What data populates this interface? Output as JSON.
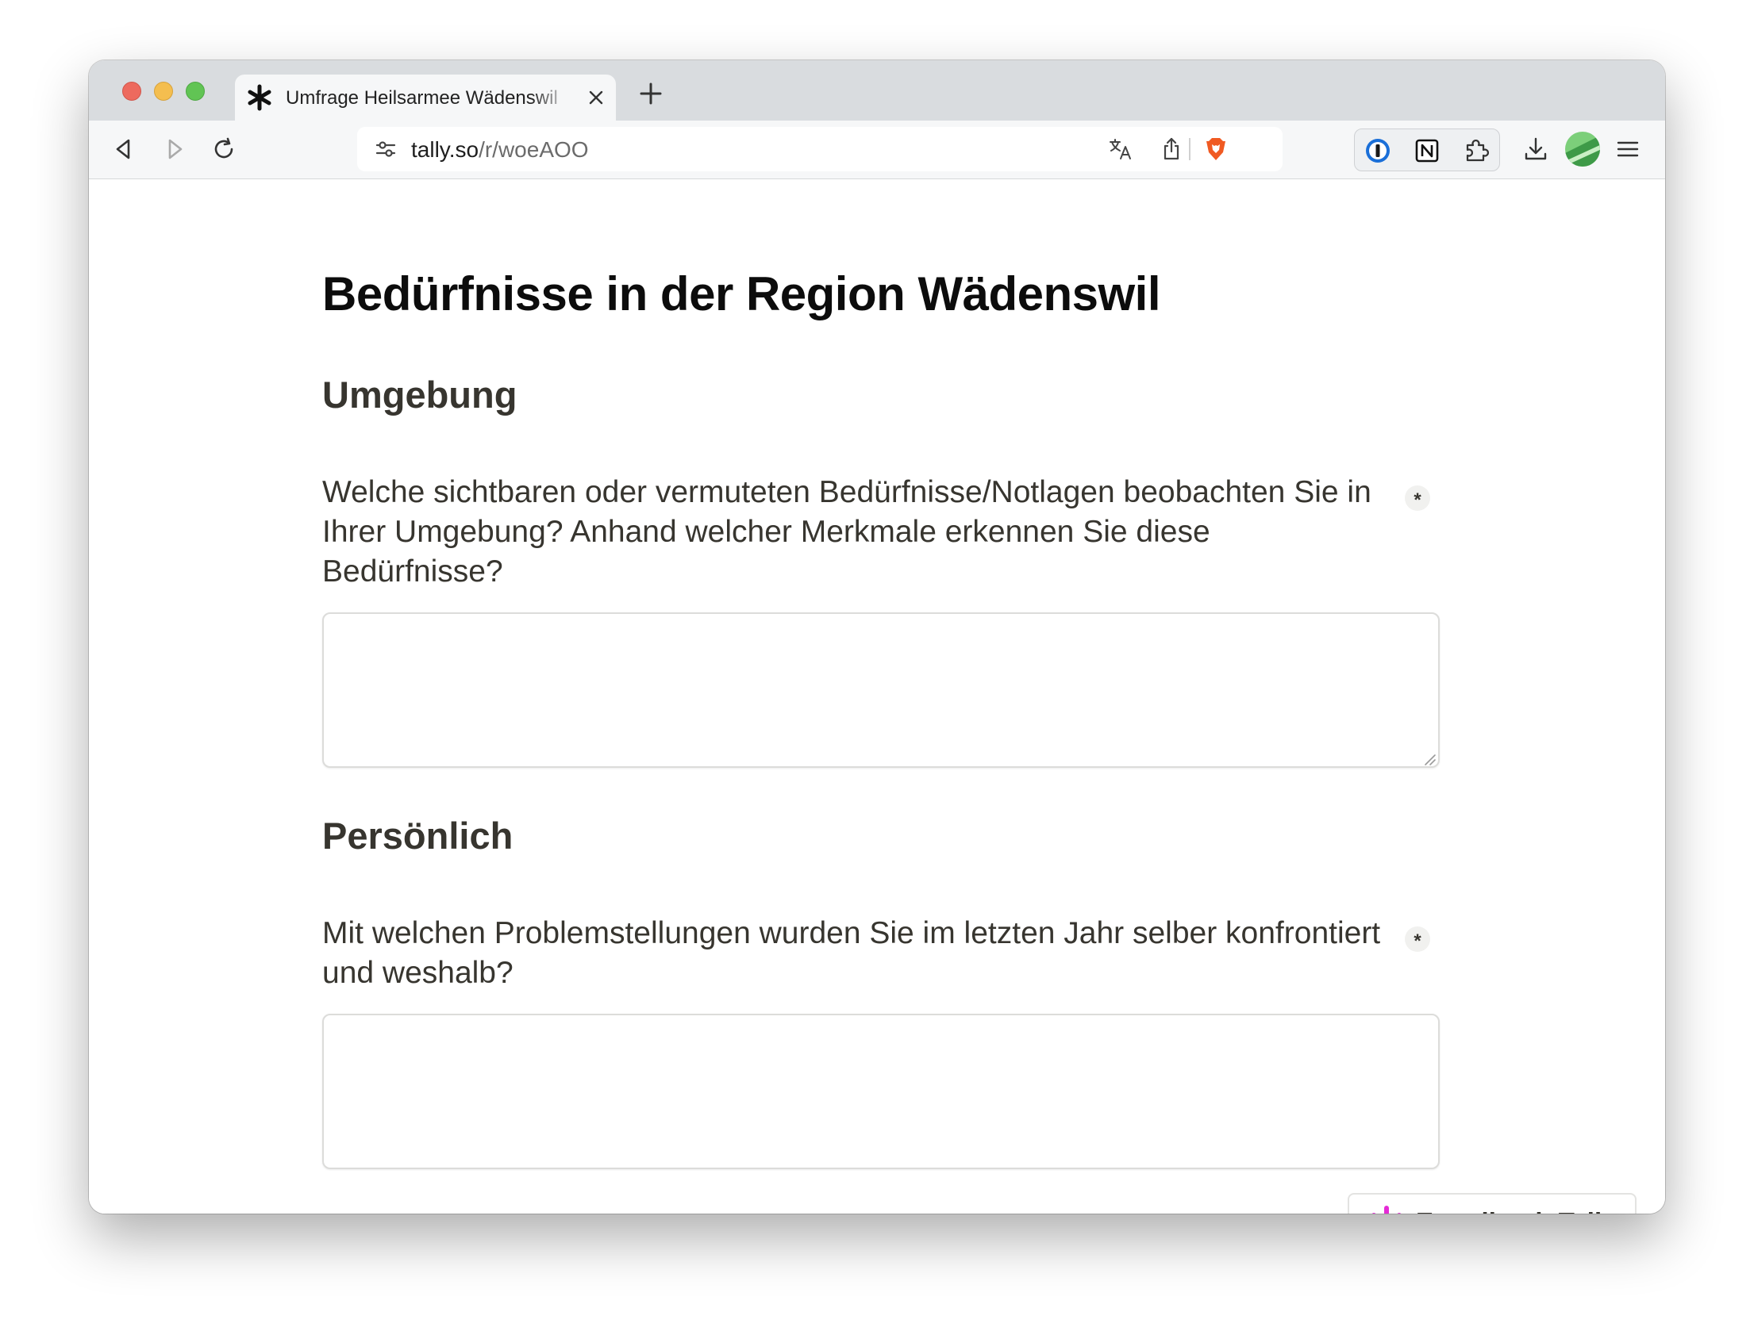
{
  "browser": {
    "tab": {
      "title": "Umfrage Heilsarmee Wädenswil"
    },
    "url": {
      "host": "tally.so",
      "path": "/r/woeAOO"
    }
  },
  "form": {
    "title": "Bedürfnisse in der Region Wädenswil",
    "sections": [
      {
        "heading": "Umgebung",
        "question": "Welche sichtbaren oder vermuteten Bedürfnisse/Notlagen beobachten Sie in Ihrer Umgebung? Anhand welcher Merkmale erkennen Sie diese Bedürfnisse?",
        "required_mark": "*",
        "answer": ""
      },
      {
        "heading": "Persönlich",
        "question": "Mit welchen Problemstellungen wurden Sie im letzten Jahr selber konfrontiert und weshalb?",
        "required_mark": "*",
        "answer": ""
      }
    ]
  },
  "badge": {
    "label": "Erstellt mit Tally"
  },
  "colors": {
    "accent_pink": "#e52ad6",
    "brave_orange": "#f05a22",
    "text": "#37352f"
  }
}
